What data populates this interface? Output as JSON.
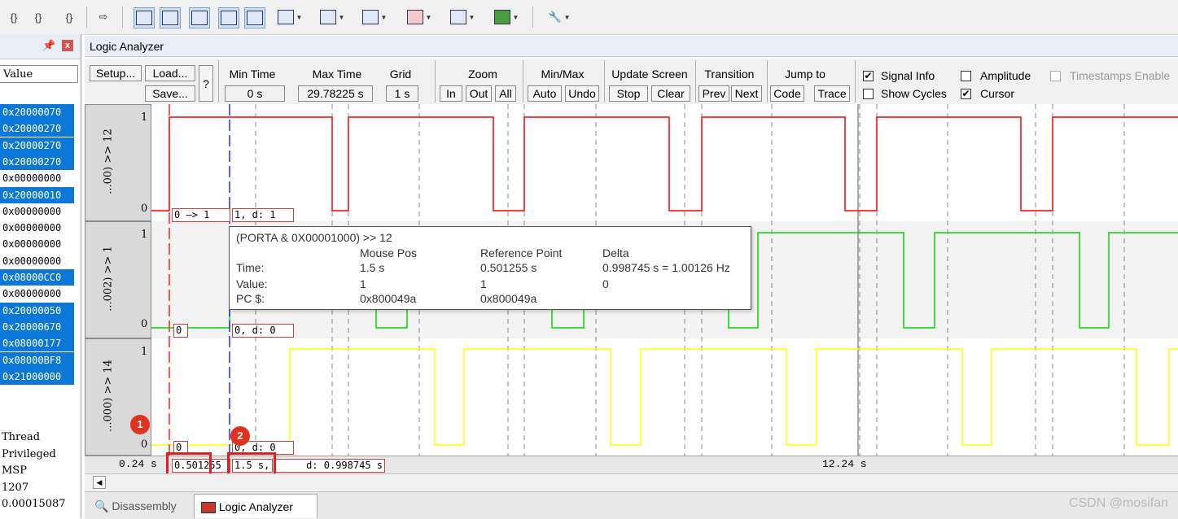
{
  "toolbar": {
    "icons": [
      "step-into-icon",
      "step-over-icon",
      "step-out-icon",
      "run-to-cursor-icon",
      "command-window-icon",
      "disassembly-window-icon",
      "symbols-window-icon",
      "registers-window-icon",
      "call-stack-icon",
      "watch-window-icon",
      "memory-window-icon",
      "serial-window-icon",
      "analysis-window-icon",
      "trace-window-icon",
      "system-viewer-icon",
      "toolbox-icon"
    ]
  },
  "left_panel": {
    "pin": "❑",
    "close": "x",
    "value_header": "Value",
    "values": [
      {
        "text": "0x20000070",
        "selected": true
      },
      {
        "text": "0x20000270",
        "selected": true
      },
      {
        "text": "0x20000270",
        "selected": true
      },
      {
        "text": "0x20000270",
        "selected": true
      },
      {
        "text": "0x00000000",
        "selected": false
      },
      {
        "text": "0x20000010",
        "selected": true
      },
      {
        "text": "0x00000000",
        "selected": false
      },
      {
        "text": "0x00000000",
        "selected": false
      },
      {
        "text": "0x00000000",
        "selected": false
      },
      {
        "text": "0x00000000",
        "selected": false
      },
      {
        "text": "0x08000CC0",
        "selected": true
      },
      {
        "text": "0x00000000",
        "selected": false
      },
      {
        "text": "0x20000050",
        "selected": true
      },
      {
        "text": "0x20000670",
        "selected": true
      },
      {
        "text": "0x08000177",
        "selected": true
      },
      {
        "text": "0x08000BF8",
        "selected": true
      },
      {
        "text": "0x21000000",
        "selected": true
      }
    ],
    "reg_rows": [
      "Thread",
      "Privileged",
      "MSP",
      "1207",
      "0.00015087"
    ]
  },
  "analyzer": {
    "title": "Logic Analyzer",
    "setup": "Setup...",
    "load": "Load...",
    "save": "Save...",
    "help": "?",
    "min_time_label": "Min Time",
    "min_time": "0 s",
    "max_time_label": "Max Time",
    "max_time": "29.78225 s",
    "grid_label": "Grid",
    "grid": "1 s",
    "zoom_label": "Zoom",
    "zoom_in": "In",
    "zoom_out": "Out",
    "zoom_all": "All",
    "minmax_label": "Min/Max",
    "auto": "Auto",
    "undo": "Undo",
    "update_label": "Update Screen",
    "stop": "Stop",
    "clear": "Clear",
    "transition_label": "Transition",
    "prev": "Prev",
    "next": "Next",
    "jump_label": "Jump to",
    "code": "Code",
    "trace": "Trace",
    "signal_info": "Signal Info",
    "signal_info_checked": true,
    "amplitude": "Amplitude",
    "amplitude_checked": false,
    "timestamps": "Timestamps Enable",
    "show_cycles": "Show Cycles",
    "show_cycles_checked": false,
    "cursor": "Cursor",
    "cursor_checked": true
  },
  "signals": [
    {
      "name": "...00) >> 12",
      "high": "1",
      "low": "0",
      "color": "#ff0000",
      "marker_left": "0 —> 1",
      "marker_right": "1,   d: 1"
    },
    {
      "name": "...002) >> 1",
      "high": "1",
      "low": "0",
      "color": "#00dd00",
      "marker_left": "0",
      "marker_right": "0,   d: 0"
    },
    {
      "name": "...000) >> 14",
      "high": "1",
      "low": "0",
      "color": "#ffff00",
      "marker_left": "0",
      "marker_right": "0,   d: 0"
    }
  ],
  "tooltip": {
    "title": "(PORTA & 0X00001000) >> 12",
    "col_mouse": "Mouse Pos",
    "col_ref": "Reference Point",
    "col_delta": "Delta",
    "time_label": "Time:",
    "time_mouse": "1.5 s",
    "time_ref": "0.501255 s",
    "time_delta": "0.998745 s = 1.00126 Hz",
    "value_label": "Value:",
    "value_mouse": "1",
    "value_ref": "1",
    "value_delta": "0",
    "pc_label": "PC $:",
    "pc_mouse": "0x800049a",
    "pc_ref": "0x800049a"
  },
  "time_axis": {
    "left": "0.24 s",
    "ref_cursor": "0.501255",
    "mouse_cursor": "1.5 s,",
    "delta": "d: 0.998745 s",
    "center": "12.24 s"
  },
  "callouts": [
    "1",
    "2"
  ],
  "tabs": {
    "disassembly": "Disassembly",
    "logic_analyzer": "Logic Analyzer"
  },
  "watermark": "CSDN @mosifan"
}
